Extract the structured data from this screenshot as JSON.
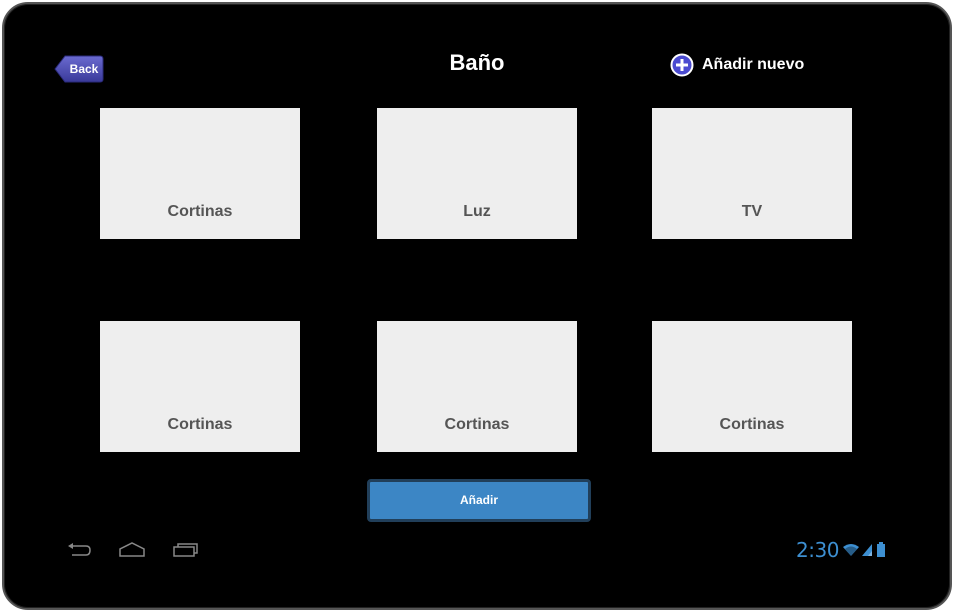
{
  "header": {
    "back_label": "Back",
    "title": "Baño",
    "add_new_label": "Añadir nuevo"
  },
  "tiles": [
    {
      "label": "Cortinas"
    },
    {
      "label": "Luz"
    },
    {
      "label": "TV"
    },
    {
      "label": "Cortinas"
    },
    {
      "label": "Cortinas"
    },
    {
      "label": "Cortinas"
    }
  ],
  "add_button_label": "Añadir",
  "navbar": {
    "icons": [
      "back-icon",
      "home-icon",
      "recent-apps-icon"
    ]
  },
  "status_bar": {
    "time": "2:30",
    "icons": [
      "wifi-icon",
      "signal-icon",
      "battery-icon"
    ]
  },
  "colors": {
    "background": "#000000",
    "tile": "#eeeeee",
    "tile_text": "#555555",
    "accent": "#3c86c5",
    "back_button": "#4a4ab0",
    "status": "#3d8fd1"
  }
}
